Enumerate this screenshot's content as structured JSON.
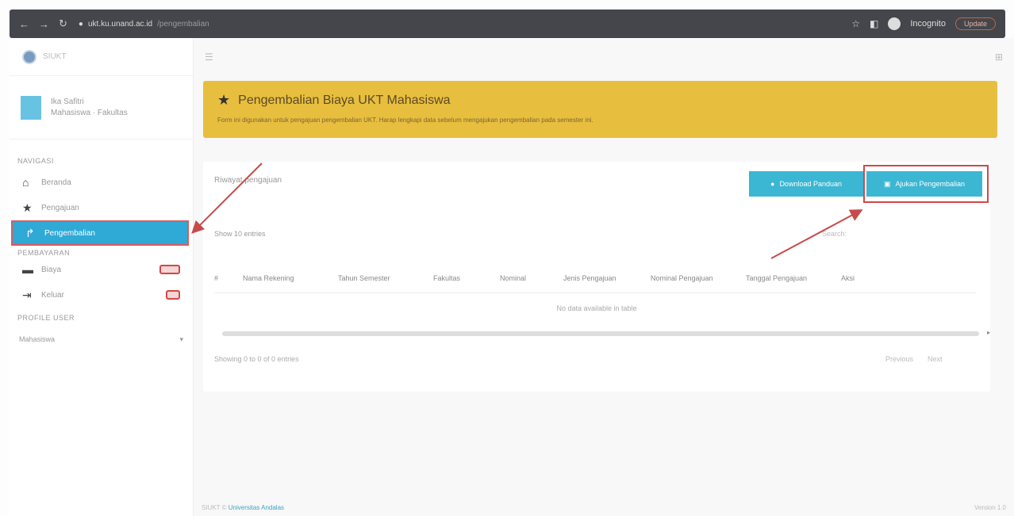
{
  "browser": {
    "url": "ukt.ku.unand.ac.id",
    "url_path": "/pengembalian",
    "profile": "Incognito",
    "update_label": "Update"
  },
  "sidebar": {
    "app_name": "SIUKT",
    "user": {
      "name": "Ika Safitri",
      "subtitle": "Mahasiswa · Fakultas"
    },
    "sections": {
      "main": "NAVIGASI",
      "tagihan": "PEMBAYARAN",
      "profile": "PROFILE USER"
    },
    "items": [
      {
        "label": "Beranda",
        "icon": "home-icon"
      },
      {
        "label": "Pengajuan",
        "icon": "star-icon"
      },
      {
        "label": "Pengembalian",
        "icon": "share-icon"
      },
      {
        "label": "Biaya",
        "icon": "card-icon"
      },
      {
        "label": "Keluar",
        "icon": "logout-icon"
      }
    ],
    "role_select": "Mahasiswa"
  },
  "alert": {
    "title": "Pengembalian Biaya UKT Mahasiswa",
    "description": "Form ini digunakan untuk pengajuan pengembalian UKT. Harap lengkapi data sebelum mengajukan pengembalian pada semester ini."
  },
  "card": {
    "heading": "Riwayat pengajuan",
    "download_label": "Download Panduan",
    "new_label": "Ajukan Pengembalian",
    "length_label": "Show 10 entries",
    "search_label": "Search:",
    "columns": [
      "#",
      "Nama Rekening",
      "Tahun Semester",
      "Fakultas",
      "Nominal",
      "Jenis Pengajuan",
      "Nominal Pengajuan",
      "Tanggal Pengajuan",
      "Aksi"
    ],
    "empty": "No data available in table",
    "info": "Showing 0 to 0 of 0 entries",
    "prev": "Previous",
    "next": "Next"
  },
  "footer": {
    "left": "SIUKT © ",
    "link": "Universitas Andalas",
    "right": "Version 1.0"
  },
  "colors": {
    "accent": "#3bb6d3",
    "alert": "#e8be3f",
    "highlight": "#d04848"
  }
}
